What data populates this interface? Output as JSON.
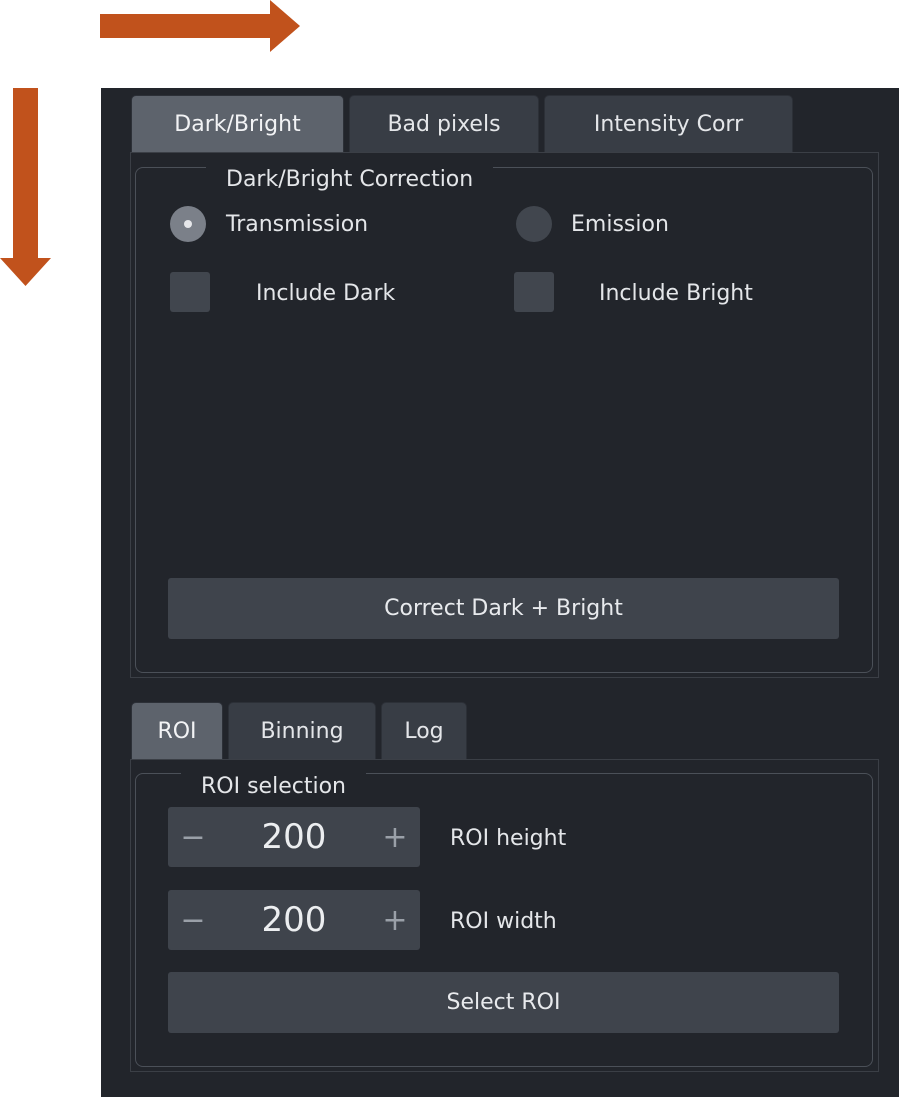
{
  "colors": {
    "arrow": "#c1521c",
    "panel_bg": "#22252b",
    "tab_active": "#5d636c",
    "tab_inactive": "#383d45",
    "control_bg": "#3f444c",
    "text": "#e4e6e9"
  },
  "annotations": {
    "horizontal_arrow_icon": "arrow-right-icon",
    "vertical_arrow_icon": "arrow-down-icon"
  },
  "top_tabs": {
    "dark_bright": "Dark/Bright",
    "bad_pixels": "Bad pixels",
    "intensity_corr": "Intensity Corr",
    "active": "Dark/Bright"
  },
  "dark_bright_group": {
    "title": "Dark/Bright Correction",
    "transmission_label": "Transmission",
    "transmission_checked": true,
    "emission_label": "Emission",
    "emission_checked": false,
    "include_dark_label": "Include Dark",
    "include_dark_checked": false,
    "include_bright_label": "Include Bright",
    "include_bright_checked": false,
    "correct_button": "Correct Dark + Bright"
  },
  "bottom_tabs": {
    "roi": "ROI",
    "binning": "Binning",
    "log": "Log",
    "active": "ROI"
  },
  "roi_group": {
    "title": "ROI selection",
    "height_value": "200",
    "height_label": "ROI height",
    "width_value": "200",
    "width_label": "ROI width",
    "minus_symbol": "−",
    "plus_symbol": "+",
    "select_button": "Select ROI"
  }
}
